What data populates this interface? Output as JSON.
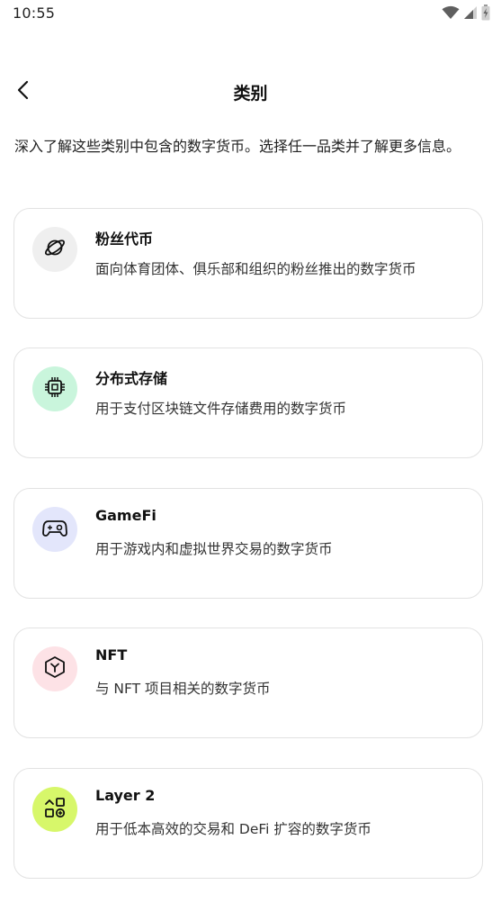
{
  "status_bar": {
    "time": "10:55",
    "icons": [
      "wifi-icon",
      "signal-icon",
      "battery-icon"
    ]
  },
  "header": {
    "back_icon": "chevron-left-icon",
    "title": "类别"
  },
  "intro": "深入了解这些类别中包含的数字货币。选择任一品类并了解更多信息。",
  "categories": [
    {
      "title": "粉丝代币",
      "description": "面向体育团体、俱乐部和组织的粉丝推出的数字货币",
      "icon": "planet-icon",
      "icon_bg": "#efefef"
    },
    {
      "title": "分布式存储",
      "description": "用于支付区块链文件存储费用的数字货币",
      "icon": "chip-icon",
      "icon_bg": "#c9f5dc"
    },
    {
      "title": "GameFi",
      "description": "用于游戏内和虚拟世界交易的数字货币",
      "icon": "gamepad-icon",
      "icon_bg": "#e3e6fb"
    },
    {
      "title": "NFT",
      "description": "与 NFT 项目相关的数字货币",
      "icon": "nft-cube-icon",
      "icon_bg": "#fde2e6"
    },
    {
      "title": "Layer 2",
      "description": "用于低本高效的交易和 DeFi 扩容的数字货币",
      "icon": "apps-icon",
      "icon_bg": "#d7f76a"
    }
  ]
}
